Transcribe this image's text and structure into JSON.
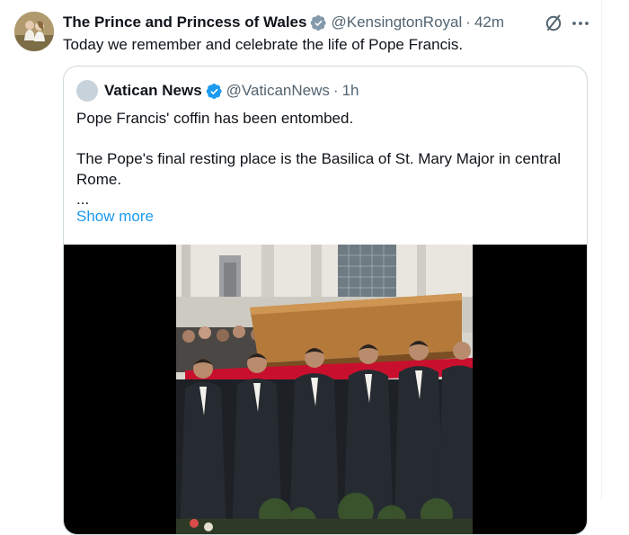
{
  "tweet": {
    "display_name": "The Prince and Princess of Wales",
    "handle": "@KensingtonRoyal",
    "separator": "·",
    "time": "42m",
    "text": "Today we remember and celebrate the life of Pope Francis.",
    "avatar_icon": "profile-photo",
    "verified_icon": "verified-badge-gray",
    "grok_icon": "grok-icon",
    "more_icon": "more-horizontal-icon"
  },
  "quote": {
    "display_name": "Vatican News",
    "handle": "@VaticanNews",
    "separator": "·",
    "time": "1h",
    "verified_icon": "verified-badge-blue",
    "line1": "Pope Francis' coffin has been entombed.",
    "line2": "The Pope's final resting place is the Basilica of St. Mary Major in central Rome.",
    "ellipsis": "...",
    "show_more": "Show more",
    "media_icon": "video-thumbnail"
  },
  "colors": {
    "text": "#0f1419",
    "secondary": "#536471",
    "link": "#1d9bf0",
    "border": "#cfd9de",
    "verified_gray": "#829aab",
    "verified_blue": "#1d9bf0"
  }
}
